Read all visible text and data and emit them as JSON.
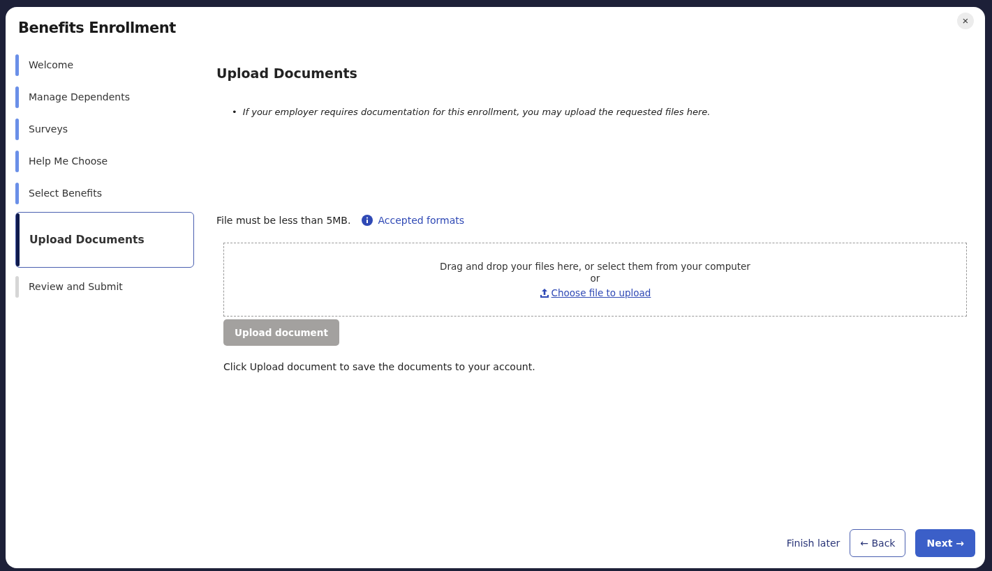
{
  "window": {
    "title": "Benefits Enrollment",
    "close": "×"
  },
  "steps": [
    {
      "label": "Welcome",
      "kind": "done",
      "selected": false
    },
    {
      "label": "Manage Dependents",
      "kind": "done",
      "selected": false
    },
    {
      "label": "Surveys",
      "kind": "done",
      "selected": false
    },
    {
      "label": "Help Me Choose",
      "kind": "done",
      "selected": false
    },
    {
      "label": "Select Benefits",
      "kind": "done",
      "selected": false
    },
    {
      "label": "Upload Documents",
      "kind": "current",
      "selected": true
    },
    {
      "label": "Review and Submit",
      "kind": "pending",
      "selected": false
    }
  ],
  "page": {
    "heading": "Upload Documents",
    "notes": [
      {
        "bullet": "•",
        "text": "If your employer requires documentation for this enrollment, you may upload the requested files here."
      }
    ],
    "size_limit": "File must be less than 5MB.",
    "formats_link": "Accepted formats",
    "dropzone": {
      "prompt": "Drag and drop your files here, or select them from your computer",
      "or": "or",
      "choose_link": "Choose file to upload"
    },
    "upload_button": {
      "label": "Upload document",
      "disabled": true
    },
    "hint": "Click Upload document to save the documents to your account."
  },
  "footer": {
    "finish_later": "Finish later",
    "back": "← Back",
    "next": "Next →"
  }
}
